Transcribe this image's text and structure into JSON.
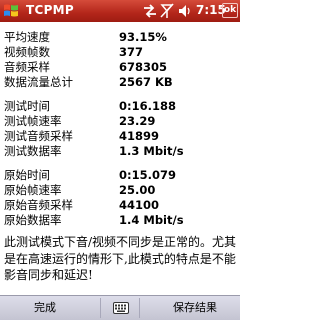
{
  "titlebar": {
    "app_title": "TCPMP",
    "clock": "7:15",
    "ok_label": "ok",
    "icons": [
      "windows-start-icon",
      "connectivity-arrows-icon",
      "antenna-off-icon",
      "speaker-icon"
    ]
  },
  "stats": {
    "avg_speed": {
      "label": "平均速度",
      "value": "93.15%"
    },
    "video_frames": {
      "label": "视频帧数",
      "value": "377"
    },
    "audio_samples": {
      "label": "音频采样",
      "value": "678305"
    },
    "data_total": {
      "label": "数据流量总计",
      "value": "2567 KB"
    },
    "test_time": {
      "label": "测试时间",
      "value": "0:16.188"
    },
    "test_fps": {
      "label": "测试帧速率",
      "value": "23.29"
    },
    "test_audio_rate": {
      "label": "测试音频采样",
      "value": "41899"
    },
    "test_data_rate": {
      "label": "测试数据率",
      "value": "1.3 Mbit/s"
    },
    "orig_time": {
      "label": "原始时间",
      "value": "0:15.079"
    },
    "orig_fps": {
      "label": "原始帧速率",
      "value": "25.00"
    },
    "orig_audio_rate": {
      "label": "原始音频采样",
      "value": "44100"
    },
    "orig_data_rate": {
      "label": "原始数据率",
      "value": "1.4 Mbit/s"
    }
  },
  "note": "此测试模式下音/视频不同步是正常的。尤其是在高速运行的情形下,此模式的特点是不能影音同步和延迟!",
  "menubar": {
    "left_label": "完成",
    "right_label": "保存结果"
  },
  "colors": {
    "titlebar": "#b3261a",
    "menubar": "#c4c4d2"
  }
}
